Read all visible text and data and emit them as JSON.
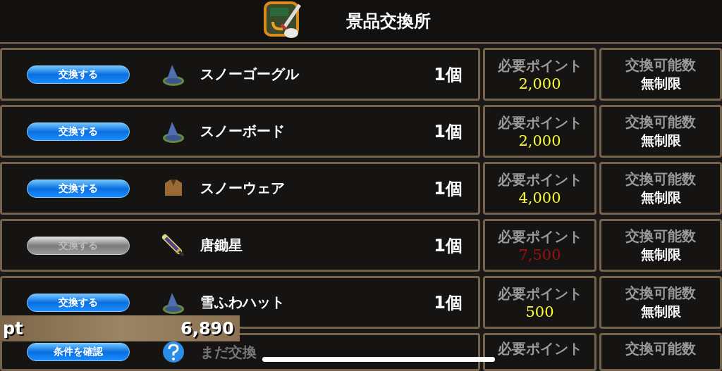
{
  "header": {
    "title": "景品交換所"
  },
  "rows": [
    {
      "button": "交換する",
      "disabled": false,
      "kind": "hat",
      "name": "スノーゴーグル",
      "count": "1個",
      "points_label": "必要ポイント",
      "points": "2,000",
      "affordable": true,
      "limit_label": "交換可能数",
      "limit": "無制限",
      "locked": false
    },
    {
      "button": "交換する",
      "disabled": false,
      "kind": "hat",
      "name": "スノーボード",
      "count": "1個",
      "points_label": "必要ポイント",
      "points": "2,000",
      "affordable": true,
      "limit_label": "交換可能数",
      "limit": "無制限",
      "locked": false
    },
    {
      "button": "交換する",
      "disabled": false,
      "kind": "garment",
      "name": "スノーウェア",
      "count": "1個",
      "points_label": "必要ポイント",
      "points": "4,000",
      "affordable": true,
      "limit_label": "交換可能数",
      "limit": "無制限",
      "locked": false
    },
    {
      "button": "交換する",
      "disabled": true,
      "kind": "sword",
      "name": "唐鋤星",
      "count": "1個",
      "points_label": "必要ポイント",
      "points": "7,500",
      "affordable": false,
      "limit_label": "交換可能数",
      "limit": "無制限",
      "locked": false
    },
    {
      "button": "交換する",
      "disabled": false,
      "kind": "hat",
      "name": "雪ふわハット",
      "count": "1個",
      "points_label": "必要ポイント",
      "points": "500",
      "affordable": true,
      "limit_label": "交換可能数",
      "limit": "無制限",
      "locked": false
    },
    {
      "button": "条件を確認",
      "disabled": false,
      "kind": "question",
      "name": "まだ交換",
      "points_label": "必要ポイント",
      "limit_label": "交換可能数",
      "locked": true
    }
  ],
  "balance": {
    "label": "pt",
    "value": "6,890"
  }
}
